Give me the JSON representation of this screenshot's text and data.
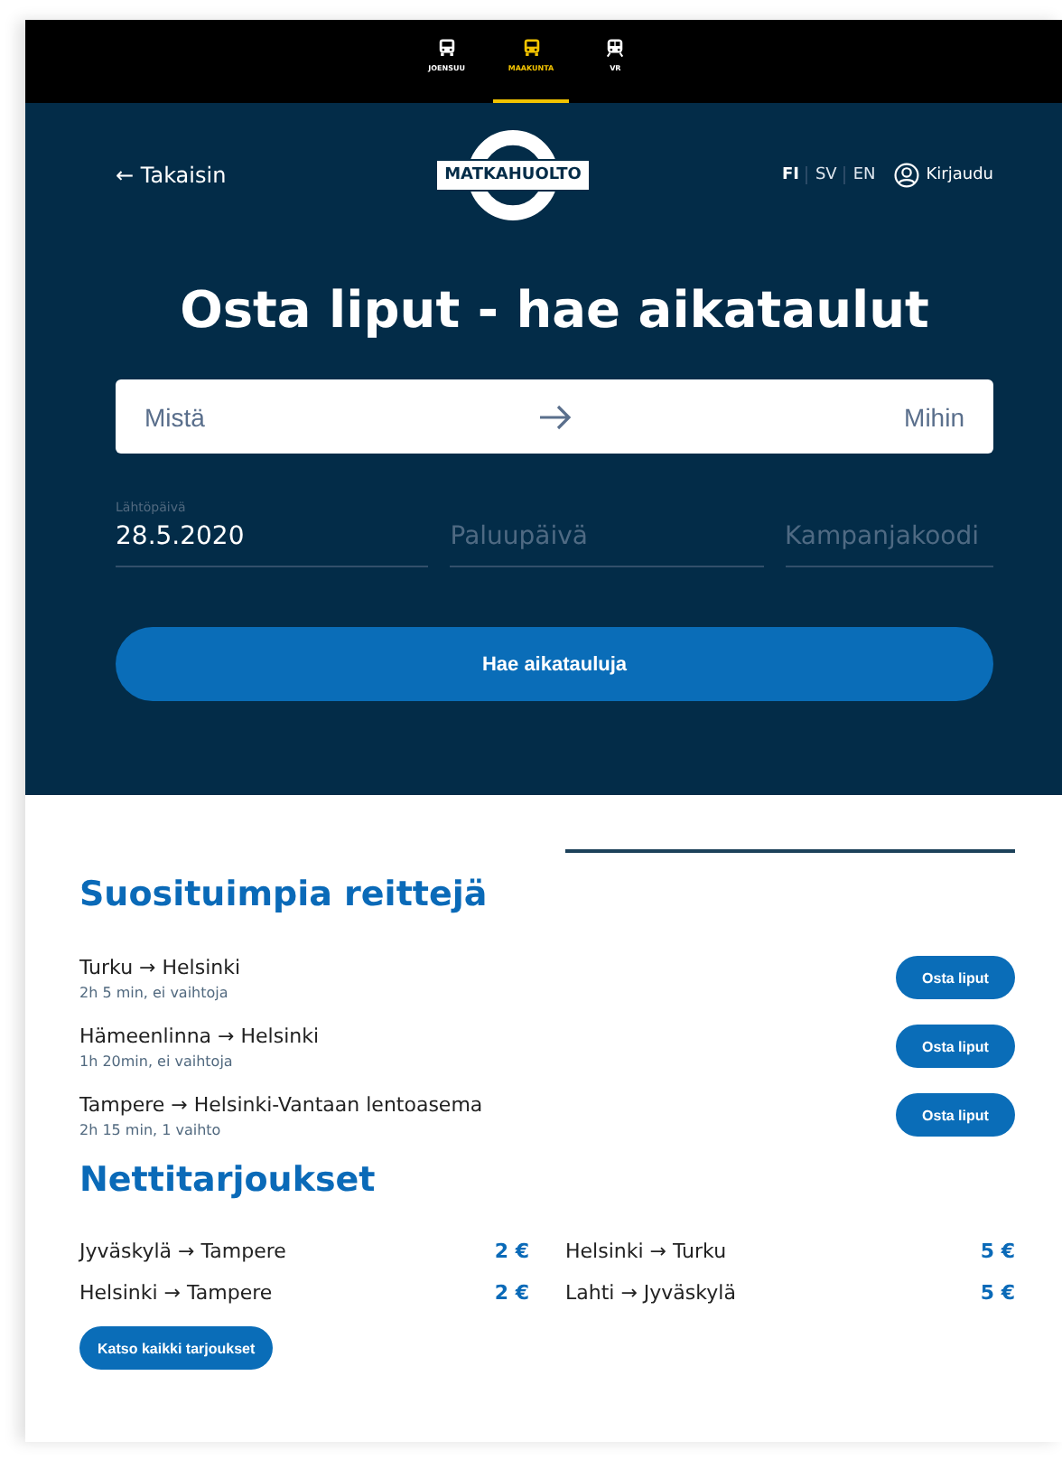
{
  "service_tabs": [
    {
      "label": "JOENSUU",
      "selected": false
    },
    {
      "label": "MAAKUNTA",
      "selected": true
    },
    {
      "label": "VR",
      "selected": false
    }
  ],
  "header": {
    "back": "← Takaisin",
    "logo": "MATKAHUOLTO",
    "languages": [
      {
        "label": "FI",
        "selected": true
      },
      {
        "label": "SV",
        "selected": false
      },
      {
        "label": "EN",
        "selected": false
      }
    ],
    "login": "Kirjaudu"
  },
  "search": {
    "title": "Osta liput - hae aikataulut",
    "from": {
      "placeholder": "Mistä"
    },
    "to": {
      "placeholder": "Mihin"
    },
    "departure": {
      "label": "Lähtöpäivä",
      "value": "28.5.2020"
    },
    "return": {
      "placeholder": "Paluupäivä"
    },
    "campaign": {
      "placeholder": "Kampanjakoodi"
    },
    "button": "Hae aikatauluja"
  },
  "popular": {
    "title": "Suosituimpia reittejä",
    "routes": [
      {
        "route": "Turku → Helsinki",
        "details": "2h 5 min, ei vaihtoja",
        "button": "Osta liput"
      },
      {
        "route": "Hämeenlinna → Helsinki",
        "details": "1h 20min, ei vaihtoja",
        "button": "Osta liput"
      },
      {
        "route": "Tampere → Helsinki-Vantaan lentoasema",
        "details": "2h 15 min, 1 vaihto",
        "button": "Osta liput"
      }
    ]
  },
  "offers": {
    "title": "Nettitarjoukset",
    "items": [
      {
        "route": "Jyväskylä → Tampere",
        "price": "2 €"
      },
      {
        "route": "Helsinki → Turku",
        "price": "5 €"
      },
      {
        "route": "Helsinki → Tampere",
        "price": "2 €"
      },
      {
        "route": "Lahti → Jyväskylä",
        "price": "5 €"
      }
    ],
    "button": "Katso kaikki tarjoukset"
  }
}
